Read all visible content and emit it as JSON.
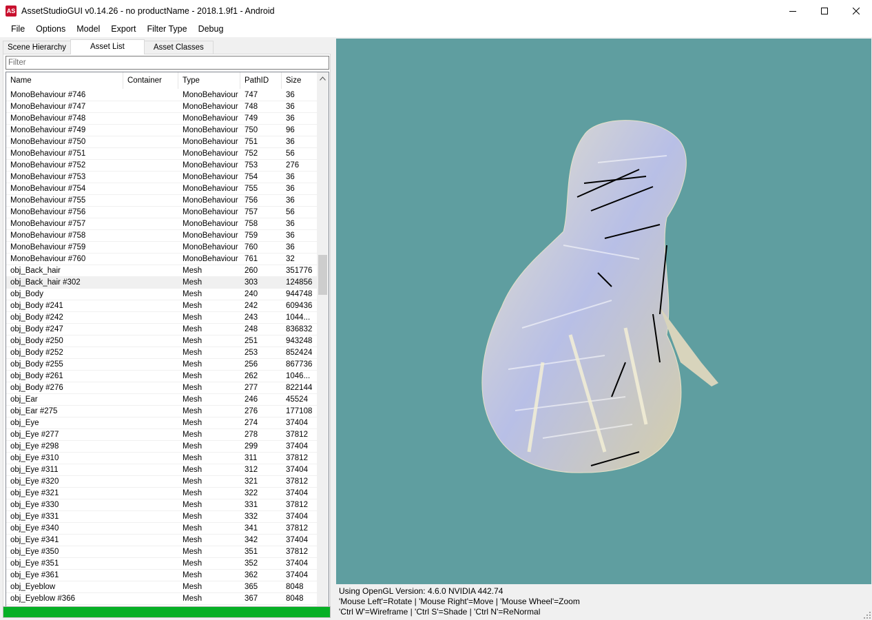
{
  "window": {
    "title": "AssetStudioGUI v0.14.26 - no productName - 2018.1.9f1 - Android",
    "icon_text": "AS",
    "controls": [
      "minimize-icon",
      "maximize-icon",
      "close-icon"
    ]
  },
  "menu": [
    "File",
    "Options",
    "Model",
    "Export",
    "Filter Type",
    "Debug"
  ],
  "tabs": [
    {
      "label": "Scene Hierarchy",
      "active": false
    },
    {
      "label": "Asset List",
      "active": true
    },
    {
      "label": "Asset Classes",
      "active": false
    }
  ],
  "filter": {
    "placeholder": "Filter",
    "value": ""
  },
  "columns": [
    "Name",
    "Container",
    "Type",
    "PathID",
    "Size"
  ],
  "rows": [
    [
      "MonoBehaviour #746",
      "",
      "MonoBehaviour",
      "747",
      "36"
    ],
    [
      "MonoBehaviour #747",
      "",
      "MonoBehaviour",
      "748",
      "36"
    ],
    [
      "MonoBehaviour #748",
      "",
      "MonoBehaviour",
      "749",
      "36"
    ],
    [
      "MonoBehaviour #749",
      "",
      "MonoBehaviour",
      "750",
      "96"
    ],
    [
      "MonoBehaviour #750",
      "",
      "MonoBehaviour",
      "751",
      "36"
    ],
    [
      "MonoBehaviour #751",
      "",
      "MonoBehaviour",
      "752",
      "56"
    ],
    [
      "MonoBehaviour #752",
      "",
      "MonoBehaviour",
      "753",
      "276"
    ],
    [
      "MonoBehaviour #753",
      "",
      "MonoBehaviour",
      "754",
      "36"
    ],
    [
      "MonoBehaviour #754",
      "",
      "MonoBehaviour",
      "755",
      "36"
    ],
    [
      "MonoBehaviour #755",
      "",
      "MonoBehaviour",
      "756",
      "36"
    ],
    [
      "MonoBehaviour #756",
      "",
      "MonoBehaviour",
      "757",
      "56"
    ],
    [
      "MonoBehaviour #757",
      "",
      "MonoBehaviour",
      "758",
      "36"
    ],
    [
      "MonoBehaviour #758",
      "",
      "MonoBehaviour",
      "759",
      "36"
    ],
    [
      "MonoBehaviour #759",
      "",
      "MonoBehaviour",
      "760",
      "36"
    ],
    [
      "MonoBehaviour #760",
      "",
      "MonoBehaviour",
      "761",
      "32"
    ],
    [
      "obj_Back_hair",
      "",
      "Mesh",
      "260",
      "351776"
    ],
    [
      "obj_Back_hair #302",
      "",
      "Mesh",
      "303",
      "124856"
    ],
    [
      "obj_Body",
      "",
      "Mesh",
      "240",
      "944748"
    ],
    [
      "obj_Body #241",
      "",
      "Mesh",
      "242",
      "609436"
    ],
    [
      "obj_Body #242",
      "",
      "Mesh",
      "243",
      "1044..."
    ],
    [
      "obj_Body #247",
      "",
      "Mesh",
      "248",
      "836832"
    ],
    [
      "obj_Body #250",
      "",
      "Mesh",
      "251",
      "943248"
    ],
    [
      "obj_Body #252",
      "",
      "Mesh",
      "253",
      "852424"
    ],
    [
      "obj_Body #255",
      "",
      "Mesh",
      "256",
      "867736"
    ],
    [
      "obj_Body #261",
      "",
      "Mesh",
      "262",
      "1046..."
    ],
    [
      "obj_Body #276",
      "",
      "Mesh",
      "277",
      "822144"
    ],
    [
      "obj_Ear",
      "",
      "Mesh",
      "246",
      "45524"
    ],
    [
      "obj_Ear #275",
      "",
      "Mesh",
      "276",
      "177108"
    ],
    [
      "obj_Eye",
      "",
      "Mesh",
      "274",
      "37404"
    ],
    [
      "obj_Eye #277",
      "",
      "Mesh",
      "278",
      "37812"
    ],
    [
      "obj_Eye #298",
      "",
      "Mesh",
      "299",
      "37404"
    ],
    [
      "obj_Eye #310",
      "",
      "Mesh",
      "311",
      "37812"
    ],
    [
      "obj_Eye #311",
      "",
      "Mesh",
      "312",
      "37404"
    ],
    [
      "obj_Eye #320",
      "",
      "Mesh",
      "321",
      "37812"
    ],
    [
      "obj_Eye #321",
      "",
      "Mesh",
      "322",
      "37404"
    ],
    [
      "obj_Eye #330",
      "",
      "Mesh",
      "331",
      "37812"
    ],
    [
      "obj_Eye #331",
      "",
      "Mesh",
      "332",
      "37404"
    ],
    [
      "obj_Eye #340",
      "",
      "Mesh",
      "341",
      "37812"
    ],
    [
      "obj_Eye #341",
      "",
      "Mesh",
      "342",
      "37404"
    ],
    [
      "obj_Eye #350",
      "",
      "Mesh",
      "351",
      "37812"
    ],
    [
      "obj_Eye #351",
      "",
      "Mesh",
      "352",
      "37404"
    ],
    [
      "obj_Eye #361",
      "",
      "Mesh",
      "362",
      "37404"
    ],
    [
      "obj_Eyeblow",
      "",
      "Mesh",
      "365",
      "8048"
    ],
    [
      "obj_Eyeblow #366",
      "",
      "Mesh",
      "367",
      "8048"
    ]
  ],
  "selected_row": 16,
  "progress": 1.0,
  "viewport": {
    "background": "#5f9ea0"
  },
  "status": {
    "line1": "Using OpenGL Version: 4.6.0 NVIDIA 442.74",
    "line2": "'Mouse Left'=Rotate | 'Mouse Right'=Move | 'Mouse Wheel'=Zoom",
    "line3": "'Ctrl W'=Wireframe | 'Ctrl S'=Shade | 'Ctrl N'=ReNormal"
  },
  "colors": {
    "progress": "#06b025",
    "viewport": "#5f9ea0",
    "app_icon": "#c8102e"
  }
}
